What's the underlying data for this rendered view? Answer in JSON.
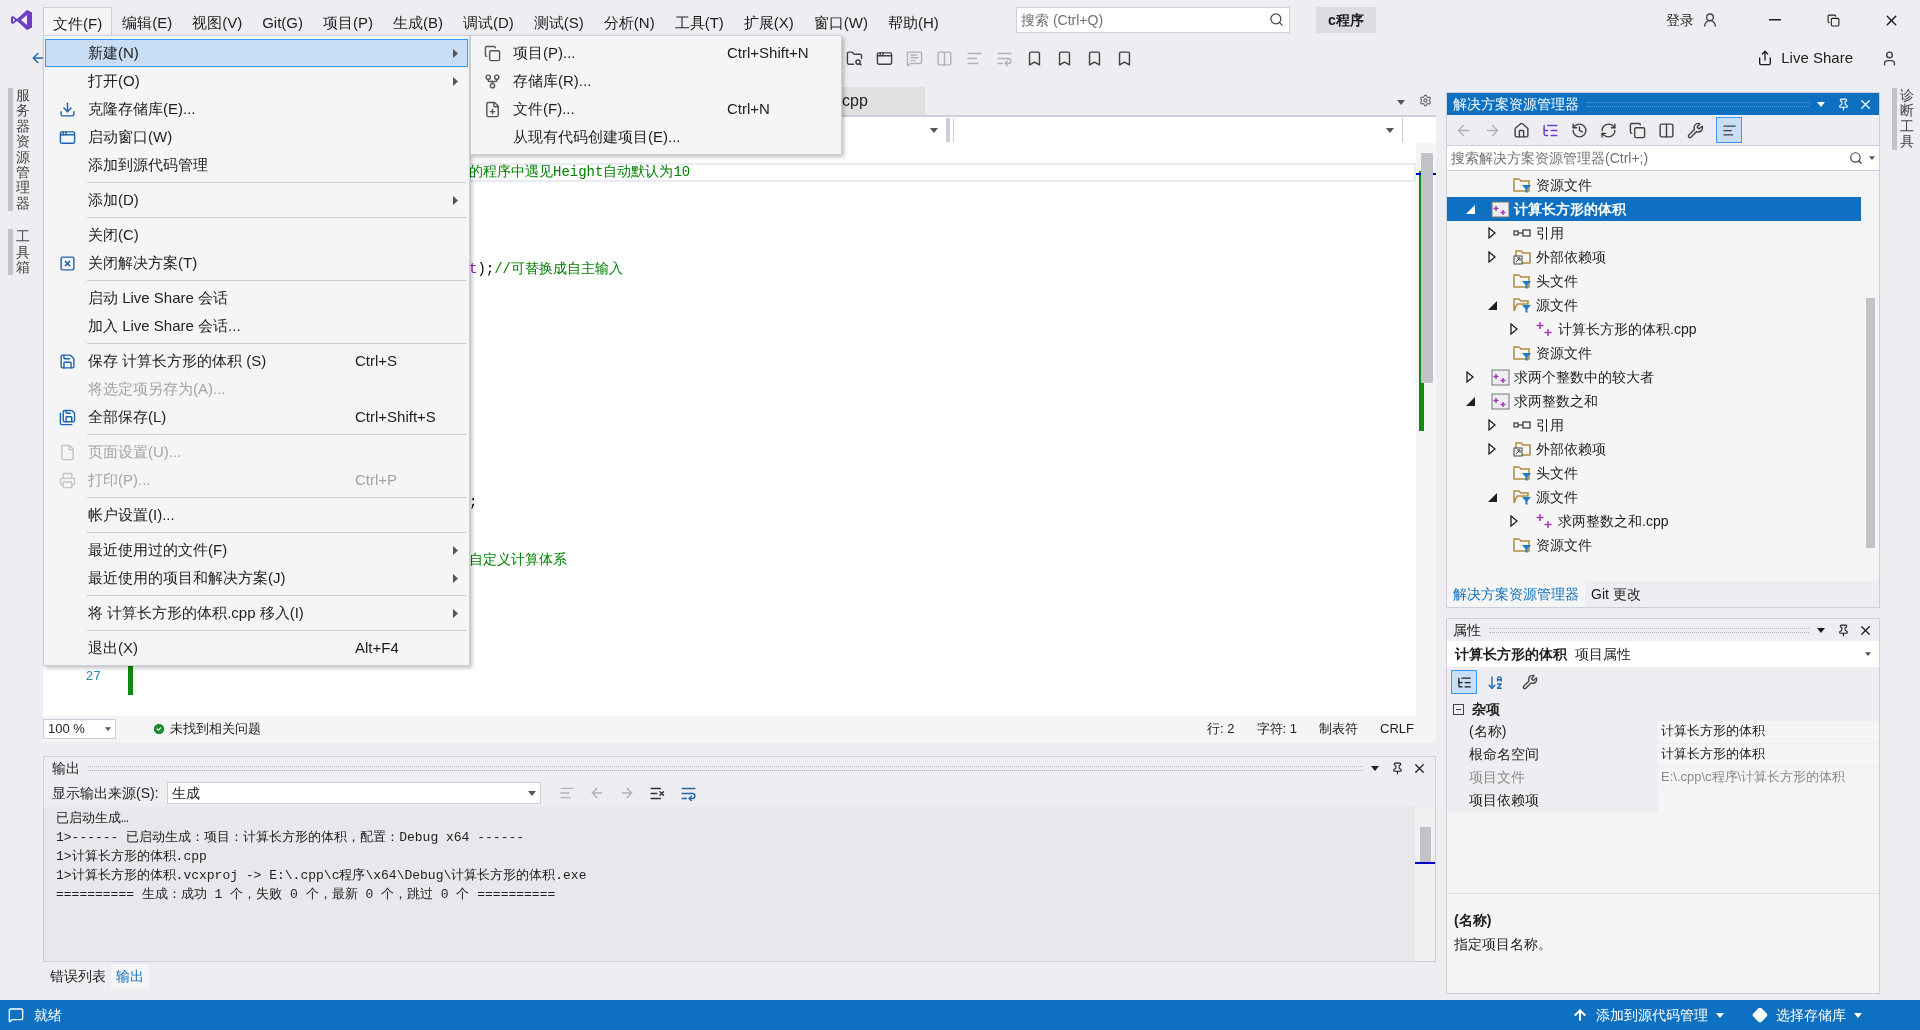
{
  "title_bar": {
    "menus": [
      {
        "label": "文件(F)",
        "selected": true
      },
      {
        "label": "编辑(E)",
        "selected": false
      },
      {
        "label": "视图(V)",
        "selected": false
      },
      {
        "label": "Git(G)",
        "selected": false
      },
      {
        "label": "项目(P)",
        "selected": false
      },
      {
        "label": "生成(B)",
        "selected": false
      },
      {
        "label": "调试(D)",
        "selected": false
      },
      {
        "label": "测试(S)",
        "selected": false
      },
      {
        "label": "分析(N)",
        "selected": false
      },
      {
        "label": "工具(T)",
        "selected": false
      },
      {
        "label": "扩展(X)",
        "selected": false
      },
      {
        "label": "窗口(W)",
        "selected": false
      },
      {
        "label": "帮助(H)",
        "selected": false
      }
    ],
    "search": {
      "placeholder": "搜索 (Ctrl+Q)"
    },
    "solution_name": "c程序",
    "sign_in": "登录"
  },
  "toolbar": {
    "live_share": "Live Share"
  },
  "file_menu": {
    "groups": [
      [
        {
          "label": "新建(N)",
          "submenu": true,
          "selected": true,
          "disabled": false
        },
        {
          "label": "打开(O)",
          "submenu": true,
          "selected": false,
          "disabled": false
        },
        {
          "label": "克隆存储库(E)...",
          "submenu": false,
          "selected": false,
          "disabled": false
        },
        {
          "label": "启动窗口(W)",
          "submenu": false,
          "selected": false,
          "disabled": false
        },
        {
          "label": "添加到源代码管理",
          "submenu": false,
          "selected": false,
          "disabled": false
        }
      ],
      [
        {
          "label": "添加(D)",
          "submenu": true,
          "selected": false,
          "disabled": false
        }
      ],
      [
        {
          "label": "关闭(C)",
          "submenu": false,
          "selected": false,
          "disabled": false
        },
        {
          "label": "关闭解决方案(T)",
          "submenu": false,
          "selected": false,
          "disabled": false
        }
      ],
      [
        {
          "label": "启动 Live Share 会话",
          "submenu": false,
          "selected": false,
          "disabled": false
        },
        {
          "label": "加入 Live Share 会话...",
          "submenu": false,
          "selected": false,
          "disabled": false
        }
      ],
      [
        {
          "label": "保存 计算长方形的体积 (S)",
          "shortcut": "Ctrl+S",
          "submenu": false,
          "selected": false,
          "disabled": false
        },
        {
          "label": "将选定项另存为(A)...",
          "submenu": false,
          "selected": false,
          "disabled": true
        },
        {
          "label": "全部保存(L)",
          "shortcut": "Ctrl+Shift+S",
          "submenu": false,
          "selected": false,
          "disabled": false
        }
      ],
      [
        {
          "label": "页面设置(U)...",
          "submenu": false,
          "selected": false,
          "disabled": true
        },
        {
          "label": "打印(P)...",
          "shortcut": "Ctrl+P",
          "submenu": false,
          "selected": false,
          "disabled": true
        }
      ],
      [
        {
          "label": "帐户设置(I)...",
          "submenu": false,
          "selected": false,
          "disabled": false
        }
      ],
      [
        {
          "label": "最近使用过的文件(F)",
          "submenu": true,
          "selected": false,
          "disabled": false
        },
        {
          "label": "最近使用的项目和解决方案(J)",
          "submenu": true,
          "selected": false,
          "disabled": false
        }
      ],
      [
        {
          "label": "将 计算长方形的体积.cpp 移入(I)",
          "submenu": true,
          "selected": false,
          "disabled": false
        }
      ],
      [
        {
          "label": "退出(X)",
          "shortcut": "Alt+F4",
          "submenu": false,
          "selected": false,
          "disabled": false
        }
      ]
    ]
  },
  "new_submenu": {
    "items": [
      {
        "label": "项目(P)...",
        "shortcut": "Ctrl+Shift+N"
      },
      {
        "label": "存储库(R)..."
      },
      {
        "label": "文件(F)...",
        "shortcut": "Ctrl+N"
      },
      {
        "label": "从现有代码创建项目(E)..."
      }
    ]
  },
  "left_side_tabs": [
    "服务器资源管理器",
    "工具箱"
  ],
  "right_side_tabs": [
    "诊断工具"
  ],
  "editor": {
    "tab": {
      "label": "cpp"
    },
    "lines": [
      {
        "current": true,
        "segments": [
          {
            "text": "的程序中遇见Height自动默认为10",
            "kind": "comment"
          }
        ]
      },
      {
        "current": false
      },
      {
        "current": false
      },
      {
        "current": false
      },
      {
        "current": false
      },
      {
        "current": false,
        "segments": [
          {
            "text": "t",
            "kind": "identifier"
          },
          {
            "text": ");",
            "kind": "plain"
          },
          {
            "text": "//可替换成自主输入",
            "kind": "comment"
          }
        ]
      },
      {
        "current": false
      },
      {
        "current": false
      },
      {
        "current": false
      },
      {
        "current": false
      },
      {
        "current": false
      },
      {
        "current": false
      },
      {
        "current": false
      },
      {
        "current": false
      },
      {
        "current": false
      },
      {
        "current": false
      },
      {
        "current": false
      },
      {
        "current": false,
        "segments": [
          {
            "text": ";",
            "kind": "plain"
          }
        ]
      },
      {
        "current": false
      },
      {
        "current": false
      },
      {
        "current": false,
        "segments": [
          {
            "text": "自定义计算体系",
            "kind": "comment"
          }
        ]
      },
      {
        "current": false
      },
      {
        "current": false
      },
      {
        "current": false
      },
      {
        "current": false
      },
      {
        "current": false
      },
      {
        "current": false,
        "number": "27"
      }
    ],
    "zoom": "100 %",
    "issues": "未找到相关问题",
    "status": [
      "行: 2",
      "字符: 1",
      "制表符",
      "CRLF"
    ]
  },
  "output": {
    "title": "输出",
    "source_label": "显示输出来源(S):",
    "source_value": "生成",
    "lines": [
      "已启动生成…",
      "1>------ 已启动生成：项目：计算长方形的体积，配置：Debug x64 ------",
      "1>计算长方形的体积.cpp",
      "1>计算长方形的体积.vcxproj -> E:\\.cpp\\c程序\\x64\\Debug\\计算长方形的体积.exe",
      "========== 生成：成功 1 个，失败 0 个，最新 0 个，跳过 0 个 =========="
    ]
  },
  "bottom_tabs": [
    {
      "label": "错误列表",
      "selected": false
    },
    {
      "label": "输出",
      "selected": true
    }
  ],
  "solution_explorer": {
    "title": "解决方案资源管理器",
    "search": {
      "placeholder": "搜索解决方案资源管理器(Ctrl+;)"
    },
    "tree": [
      {
        "children": [
          {
            "label": "资源文件",
            "kind": "filter",
            "selected": false
          }
        ]
      },
      {
        "label": "计算长方形的体积",
        "kind": "project",
        "expanded": true,
        "selected": true,
        "children": [
          {
            "label": "引用",
            "kind": "references",
            "expanded": false,
            "selected": false
          },
          {
            "label": "外部依赖项",
            "kind": "external",
            "expanded": false,
            "selected": false
          },
          {
            "label": "头文件",
            "kind": "filter",
            "selected": false
          },
          {
            "label": "源文件",
            "kind": "filter",
            "expanded": true,
            "selected": false,
            "children": [
              {
                "label": "计算长方形的体积.cpp",
                "kind": "cpp",
                "expanded": false,
                "selected": false
              }
            ]
          },
          {
            "label": "资源文件",
            "kind": "filter",
            "selected": false
          }
        ]
      },
      {
        "label": "求两个整数中的较大者",
        "kind": "project",
        "expanded": false,
        "selected": false
      },
      {
        "label": "求两整数之和",
        "kind": "project",
        "expanded": true,
        "selected": false,
        "children": [
          {
            "label": "引用",
            "kind": "references",
            "expanded": false,
            "selected": false
          },
          {
            "label": "外部依赖项",
            "kind": "external",
            "expanded": false,
            "selected": false
          },
          {
            "label": "头文件",
            "kind": "filter",
            "selected": false
          },
          {
            "label": "源文件",
            "kind": "filter",
            "expanded": true,
            "selected": false,
            "children": [
              {
                "label": "求两整数之和.cpp",
                "kind": "cpp",
                "expanded": false,
                "selected": false
              }
            ]
          },
          {
            "label": "资源文件",
            "kind": "filter",
            "selected": false
          }
        ]
      }
    ],
    "tabs": [
      {
        "label": "解决方案资源管理器",
        "selected": true
      },
      {
        "label": "Git 更改",
        "selected": false
      }
    ]
  },
  "properties": {
    "title": "属性",
    "object_name": "计算长方形的体积",
    "object_type": "项目属性",
    "category": "杂项",
    "rows": [
      {
        "name": "(名称)",
        "value": "计算长方形的体积",
        "readonly": false
      },
      {
        "name": "根命名空间",
        "value": "计算长方形的体积",
        "readonly": false
      },
      {
        "name": "项目文件",
        "value": "E:\\.cpp\\c程序\\计算长方形的体积",
        "readonly": true
      },
      {
        "name": "项目依赖项",
        "readonly": false
      }
    ],
    "description_title": "(名称)",
    "description": "指定项目名称。"
  },
  "status_bar": {
    "text": "就绪",
    "source_control": "添加到源代码管理",
    "repository": "选择存储库"
  }
}
